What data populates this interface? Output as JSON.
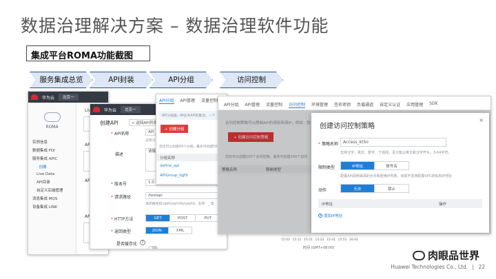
{
  "slide": {
    "title": "数据治理解决方案 – 数据治理软件功能",
    "subtitle": "集成平台ROMA功能截图",
    "steps": [
      "服务集成总览",
      "API封装",
      "API分组",
      "访问控制"
    ],
    "watermark": "肉眼品世界",
    "footer_company": "Huawei Technologies Co., Ltd.",
    "page_number": "22",
    "colors": {
      "accent": "#1e7fd8",
      "danger": "#e4393c",
      "step_fill": "#dde7f5",
      "step_border": "#2c4f8a"
    }
  },
  "shot1": {
    "brand": "华为云",
    "region": "北京一",
    "product": "ROMA",
    "nav": [
      "实例信息",
      "数据集成 FDI",
      "服务集成 APIC",
      "· 创建",
      "Live Data",
      "API目录",
      "自定义后端管理",
      "消息集成 MQS",
      "设备集成 LINK"
    ],
    "stub_labels": [
      "Live",
      "AP",
      "AP",
      "AP"
    ]
  },
  "shot2": {
    "brand": "华为云",
    "region": "北京一",
    "title": "创建API",
    "back": "< 返回API列表",
    "fields": {
      "name_label": "API名称",
      "name_value": "API_",
      "name_hint": "支持汉",
      "desc_label": "描述",
      "desc_value": "请输入",
      "version_label": "版本号",
      "version_value": "1.0",
      "path_label": "请求路径",
      "path_value": "/testapi",
      "path_hint": "请求路径如:/getUserInfo/userId。支持：_ 等",
      "method_label": "HTTP方法",
      "methods": [
        "GET",
        "POST",
        "PUT"
      ],
      "type_label": "返回类型",
      "types": [
        "JSON",
        "XML"
      ],
      "cache_label": "是否缓存化"
    }
  },
  "shot3": {
    "tabs": [
      "API分组",
      "API管理",
      "流量控制"
    ],
    "info": "API分组是一种业务API的集合，一个",
    "create_button": "+ 创建分组",
    "quota": "您还可以创建49个分组，最多可创建50个",
    "column": "分组名称",
    "rows": [
      "define_api",
      "APIGroup_bgf9"
    ]
  },
  "shot4": {
    "tabs": [
      "API分组",
      "API管理",
      "流量控制",
      "访问控制",
      "环境管理",
      "签名密钥",
      "负载通道",
      "自定义认证",
      "应用管理",
      "SDK"
    ],
    "info": "访问控制策略可以限制API的调用来源IP，例如：防",
    "create_button": "+ 创建访问控制策略",
    "quota": "您还可以创建100个访问控制，最多可创建100个访问",
    "columns": [
      "策略名称",
      "限制类型"
    ],
    "dialog": {
      "title": "创建访问控制策略",
      "name_label": "策略名称",
      "name_value": "Access_kt5o",
      "name_hint": "支持汉字、英文、数字、下划线，且只能以英文和汉字开头，3-64字符。",
      "type_label": "限制类型",
      "types": [
        "IP地址",
        "账号名"
      ],
      "type_hint": "配置API调用来源的允许和拒绝IP列表，目前不支持配置VPC的私有IP地址",
      "action_label": "动作",
      "actions": [
        "允许",
        "禁止"
      ],
      "col_ip": "IP地址",
      "col_op": "操作",
      "add_link": "增加IP地址",
      "close": "×"
    }
  },
  "chart_fragment": {
    "ticks": [
      "15:01",
      "15:11",
      "15:21",
      "15:31",
      "15:41",
      "15:51",
      "16:01"
    ],
    "xlabel": "时间 (GMT+08:00)"
  }
}
